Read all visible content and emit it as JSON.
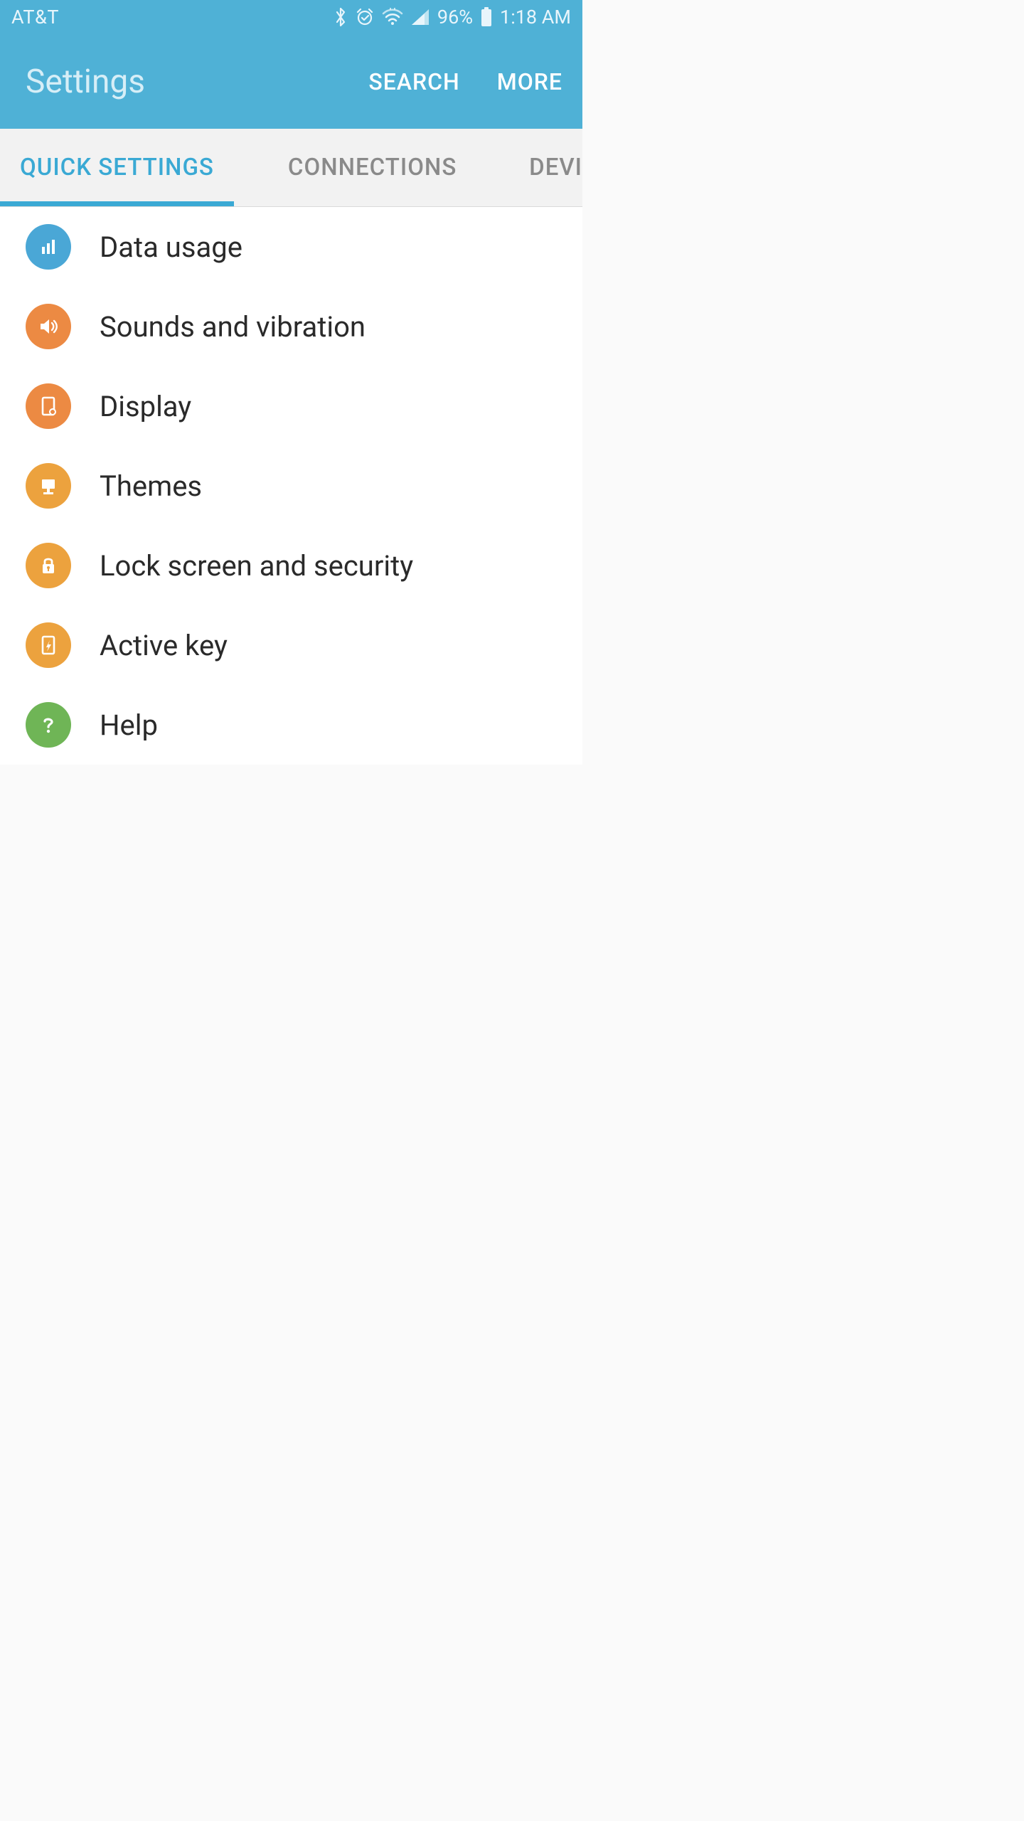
{
  "status_bar": {
    "carrier": "AT&T",
    "battery_percent": "96%",
    "time": "1:18 AM"
  },
  "app_bar": {
    "title": "Settings",
    "actions": {
      "search": "SEARCH",
      "more": "MORE"
    }
  },
  "tabs": {
    "quick_settings": "QUICK SETTINGS",
    "connections": "CONNECTIONS",
    "device": "DEVI"
  },
  "items": [
    {
      "label": "Data usage"
    },
    {
      "label": "Sounds and vibration"
    },
    {
      "label": "Display"
    },
    {
      "label": "Themes"
    },
    {
      "label": "Lock screen and security"
    },
    {
      "label": "Active key"
    },
    {
      "label": "Help"
    }
  ]
}
